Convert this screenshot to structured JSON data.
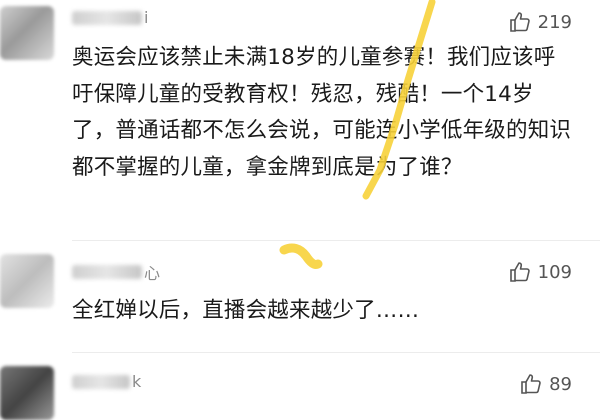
{
  "comments": [
    {
      "name_suffix": "i",
      "likes": "219",
      "text": "奥运会应该禁止未满18岁的儿童参赛！我们应该呼吁保障儿童的受教育权！残忍，残酷！一个14岁了，普通话都不怎么会说，可能连小学低年级的知识都不掌握的儿童，拿金牌到底是为了谁？"
    },
    {
      "name_suffix": "心",
      "likes": "109",
      "text": "全红婵以后，直播会越来越少了……"
    },
    {
      "name_suffix": "k",
      "likes": "89",
      "text": ""
    }
  ],
  "icons": {
    "like": "thumbs-up-icon"
  },
  "colors": {
    "highlight": "#f7d23a",
    "muted": "#8a8a8a"
  }
}
